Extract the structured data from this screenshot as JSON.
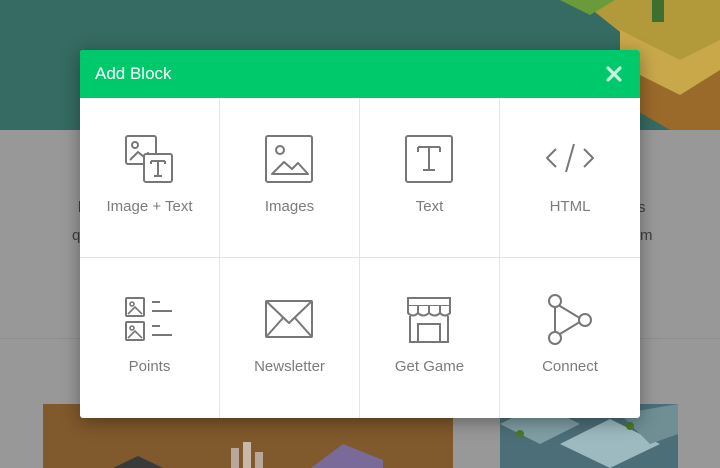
{
  "page": {
    "side_text": {
      "left_lines": [
        "l",
        "q"
      ],
      "right_lines": [
        "s",
        "m"
      ]
    }
  },
  "modal": {
    "title": "Add Block",
    "accent_color": "#00c96b",
    "close_icon": "close-icon",
    "tiles": [
      {
        "label": "Image + Text",
        "icon": "image-text-icon"
      },
      {
        "label": "Images",
        "icon": "image-icon"
      },
      {
        "label": "Text",
        "icon": "text-icon"
      },
      {
        "label": "HTML",
        "icon": "code-icon"
      },
      {
        "label": "Points",
        "icon": "checklist-icon"
      },
      {
        "label": "Newsletter",
        "icon": "envelope-icon"
      },
      {
        "label": "Get Game",
        "icon": "storefront-icon"
      },
      {
        "label": "Connect",
        "icon": "share-icon"
      }
    ]
  }
}
